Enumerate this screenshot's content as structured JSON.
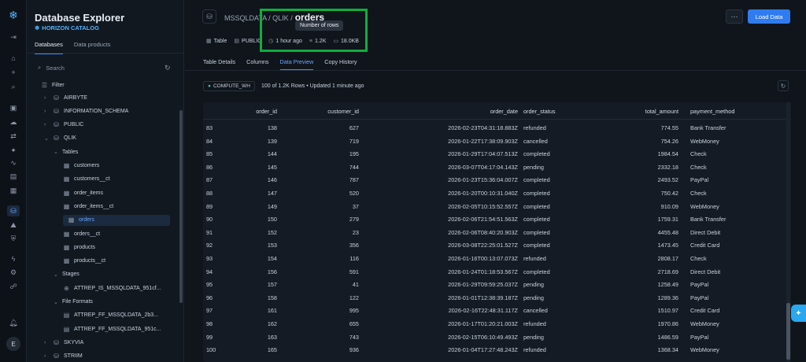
{
  "rail": {
    "avatar_letter": "E"
  },
  "explorer": {
    "title": "Database Explorer",
    "catalog": "HORIZON CATALOG",
    "tabs": [
      "Databases",
      "Data products"
    ],
    "search_placeholder": "Search",
    "filter_label": "Filter",
    "tree": [
      {
        "label": "AIRBYTE",
        "depth": 1,
        "icon": "schema-icon",
        "chev": "›"
      },
      {
        "label": "INFORMATION_SCHEMA",
        "depth": 1,
        "icon": "schema-icon",
        "chev": "›"
      },
      {
        "label": "PUBLIC",
        "depth": 1,
        "icon": "schema-icon",
        "chev": "›"
      },
      {
        "label": "QLIK",
        "depth": 1,
        "icon": "schema-icon",
        "chev": "⌄"
      },
      {
        "label": "Tables",
        "depth": 2,
        "icon": "",
        "chev": "⌄"
      },
      {
        "label": "customers",
        "depth": 3,
        "icon": "table-icon",
        "chev": ""
      },
      {
        "label": "customers__ct",
        "depth": 3,
        "icon": "table-icon",
        "chev": ""
      },
      {
        "label": "order_items",
        "depth": 3,
        "icon": "table-icon",
        "chev": ""
      },
      {
        "label": "order_items__ct",
        "depth": 3,
        "icon": "table-icon",
        "chev": ""
      },
      {
        "label": "orders",
        "depth": 3,
        "icon": "table-icon",
        "chev": "",
        "selected": true
      },
      {
        "label": "orders__ct",
        "depth": 3,
        "icon": "table-icon",
        "chev": ""
      },
      {
        "label": "products",
        "depth": 3,
        "icon": "table-icon",
        "chev": ""
      },
      {
        "label": "products__ct",
        "depth": 3,
        "icon": "table-icon",
        "chev": ""
      },
      {
        "label": "Stages",
        "depth": 2,
        "icon": "",
        "chev": "⌄"
      },
      {
        "label": "ATTREP_IS_MSSQLDATA_951cf...",
        "depth": 3,
        "icon": "stage-icon",
        "chev": ""
      },
      {
        "label": "File Formats",
        "depth": 2,
        "icon": "",
        "chev": "⌄"
      },
      {
        "label": "ATTREP_FF_MSSQLDATA_2b3...",
        "depth": 3,
        "icon": "file-format-icon",
        "chev": ""
      },
      {
        "label": "ATTREP_FF_MSSQLDATA_951c...",
        "depth": 3,
        "icon": "file-format-icon",
        "chev": ""
      },
      {
        "label": "SKYVIA",
        "depth": 1,
        "icon": "schema-icon",
        "chev": "›"
      },
      {
        "label": "STRIIM",
        "depth": 1,
        "icon": "schema-icon",
        "chev": "›"
      }
    ]
  },
  "header": {
    "path": "MSSQLDATA / QLIK /",
    "table_name": "orders",
    "more_label": "···",
    "load_label": "Load Data",
    "meta": {
      "type": "Table",
      "schema": "PUBLIC",
      "updated": "1 hour ago",
      "rows": "1.2K",
      "size": "18.0KB"
    },
    "tooltip": "Number of rows"
  },
  "tabs": [
    "Table Details",
    "Columns",
    "Data Preview",
    "Copy History"
  ],
  "preview": {
    "warehouse": "COMPUTE_WH",
    "row_info": "100 of 1.2K Rows • Updated 1 minute ago"
  },
  "grid": {
    "columns": [
      "order_id",
      "customer_id",
      "order_date",
      "order_status",
      "total_amount",
      "payment_method"
    ],
    "rows": [
      [
        "83",
        "138",
        "627",
        "2026-02-23T04:31:18.883Z",
        "refunded",
        "774.55",
        "Bank Transfer"
      ],
      [
        "84",
        "139",
        "719",
        "2026-01-22T17:38:09.903Z",
        "cancelled",
        "754.26",
        "WebMoney"
      ],
      [
        "85",
        "144",
        "195",
        "2026-01-29T17:04:07.513Z",
        "completed",
        "1984.54",
        "Check"
      ],
      [
        "86",
        "145",
        "744",
        "2026-03-07T04:17:04.143Z",
        "pending",
        "2332.18",
        "Check"
      ],
      [
        "87",
        "146",
        "787",
        "2026-01-23T15:36:04.007Z",
        "completed",
        "2493.52",
        "PayPal"
      ],
      [
        "88",
        "147",
        "520",
        "2026-01-20T00:10:31.040Z",
        "completed",
        "750.42",
        "Check"
      ],
      [
        "89",
        "149",
        "37",
        "2026-02-05T10:15:52.557Z",
        "completed",
        "910.09",
        "WebMoney"
      ],
      [
        "90",
        "150",
        "279",
        "2026-02-06T21:54:51.563Z",
        "completed",
        "1759.31",
        "Bank Transfer"
      ],
      [
        "91",
        "152",
        "23",
        "2026-02-06T08:40:20.903Z",
        "completed",
        "4455.48",
        "Direct Debit"
      ],
      [
        "92",
        "153",
        "356",
        "2026-03-08T22:25:01.527Z",
        "completed",
        "1473.45",
        "Credit Card"
      ],
      [
        "93",
        "154",
        "116",
        "2026-01-16T00:13:07.073Z",
        "refunded",
        "2808.17",
        "Check"
      ],
      [
        "94",
        "156",
        "591",
        "2026-01-24T01:18:53.567Z",
        "completed",
        "2718.69",
        "Direct Debit"
      ],
      [
        "95",
        "157",
        "41",
        "2026-01-29T09:59:25.037Z",
        "pending",
        "1258.49",
        "PayPal"
      ],
      [
        "96",
        "158",
        "122",
        "2026-01-01T12:38:39.187Z",
        "pending",
        "1289.36",
        "PayPal"
      ],
      [
        "97",
        "161",
        "995",
        "2026-02-16T22:48:31.117Z",
        "cancelled",
        "1510.97",
        "Credit Card"
      ],
      [
        "98",
        "162",
        "655",
        "2026-01-17T01:20:21.003Z",
        "refunded",
        "1970.86",
        "WebMoney"
      ],
      [
        "99",
        "163",
        "743",
        "2026-02-15T06:10:49.493Z",
        "pending",
        "1486.59",
        "PayPal"
      ],
      [
        "100",
        "165",
        "936",
        "2026-01-04T17:27:48.243Z",
        "refunded",
        "1368.34",
        "WebMoney"
      ]
    ]
  }
}
